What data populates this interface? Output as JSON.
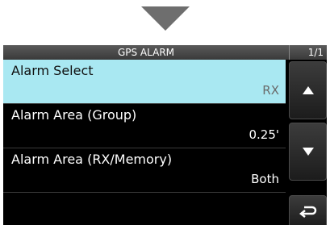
{
  "screen": {
    "title": "GPS ALARM",
    "page": "1/1"
  },
  "menu": [
    {
      "label": "Alarm Select",
      "value": "RX",
      "selected": true
    },
    {
      "label": "Alarm Area (Group)",
      "value": "0.25'",
      "selected": false
    },
    {
      "label": "Alarm Area (RX/Memory)",
      "value": "Both",
      "selected": false
    }
  ],
  "side_buttons": {
    "up_icon": "up-arrow-icon",
    "down_icon": "down-arrow-icon",
    "back_icon": "back-return-icon"
  },
  "colors": {
    "selected_bg": "#a9e8f2",
    "screen_bg": "#000000",
    "pointer_arrow": "#6e6e6e"
  }
}
